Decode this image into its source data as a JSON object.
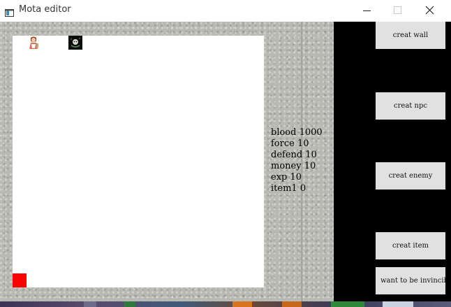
{
  "window": {
    "title": "Mota editor"
  },
  "stats": [
    {
      "label": "blood",
      "value": "1000"
    },
    {
      "label": "force",
      "value": "10"
    },
    {
      "label": "defend",
      "value": "10"
    },
    {
      "label": "money",
      "value": "10"
    },
    {
      "label": "exp",
      "value": "10"
    },
    {
      "label": "item1",
      "value": "0"
    }
  ],
  "buttons": {
    "wall": "creat wall",
    "npc": "creat npc",
    "enemy": "creat enemy",
    "item": "creat item",
    "invincible": "want to be invincible"
  },
  "icons": {
    "app": "window-app-icon",
    "minimize": "minimize-icon",
    "maximize": "maximize-icon",
    "close": "close-icon",
    "hero": "hero-sprite-icon",
    "monster": "monster-sprite-icon"
  },
  "colors": {
    "cursor": "#ff0000",
    "panel": "#000000",
    "button": "#e1e1e1"
  }
}
